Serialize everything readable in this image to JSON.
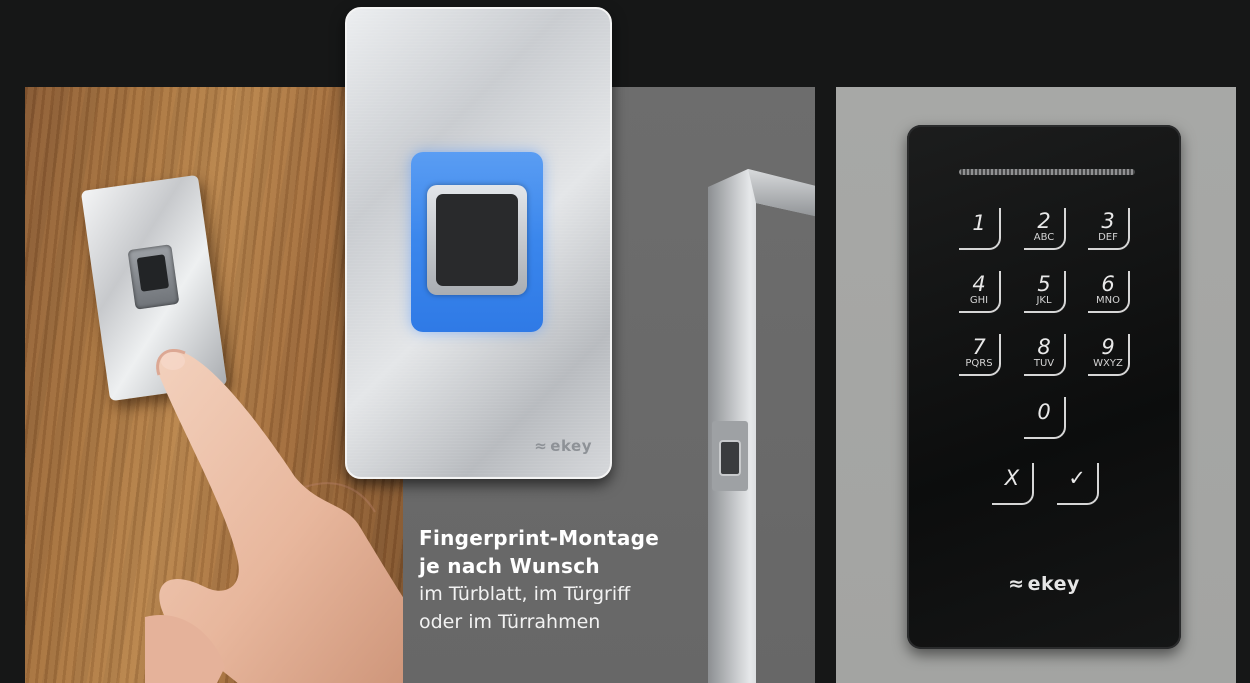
{
  "caption": {
    "title_line1": "Fingerprint-Montage",
    "title_line2": "je nach Wunsch",
    "body_line1": "im Türblatt, im Türgriff",
    "body_line2": "oder im Türrahmen"
  },
  "center_reader": {
    "brand": "ekey",
    "brand_mark": "≈"
  },
  "keypad": {
    "brand": "ekey",
    "brand_mark": "≈",
    "keys": [
      {
        "digit": "1",
        "letters": ""
      },
      {
        "digit": "2",
        "letters": "ABC"
      },
      {
        "digit": "3",
        "letters": "DEF"
      },
      {
        "digit": "4",
        "letters": "GHI"
      },
      {
        "digit": "5",
        "letters": "JKL"
      },
      {
        "digit": "6",
        "letters": "MNO"
      },
      {
        "digit": "7",
        "letters": "PQRS"
      },
      {
        "digit": "8",
        "letters": "TUV"
      },
      {
        "digit": "9",
        "letters": "WXYZ"
      },
      {
        "digit": "0",
        "letters": ""
      },
      {
        "digit": "X",
        "letters": ""
      },
      {
        "digit": "✓",
        "letters": ""
      }
    ]
  },
  "colors": {
    "background": "#161717",
    "middle_panel": "#6b6b6b",
    "right_panel": "#a6a7a5",
    "sensor_blue": "#3a86ec",
    "keypad_body": "#111212"
  }
}
